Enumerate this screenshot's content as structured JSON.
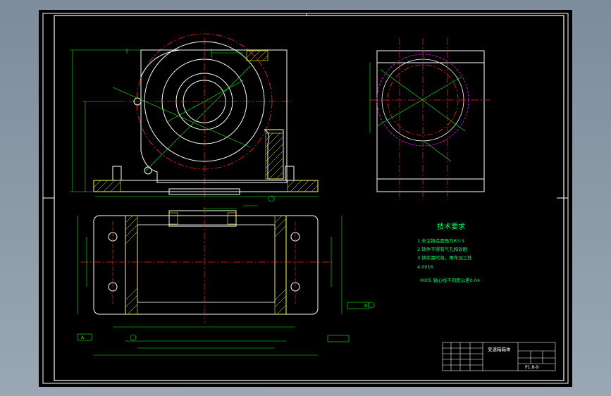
{
  "drawing": {
    "colors": {
      "background": "#000000",
      "outline": "#ffffff",
      "center_line": "#ff2020",
      "dimension": "#00ff00",
      "hatch": "#ffff00",
      "hidden": "#ff00ff",
      "notes": "#00ff66",
      "app_frame": "#8c9aa8"
    },
    "tech_req": {
      "title": "技术要求",
      "items": [
        "1.未注铸造圆角为R3-5",
        "2.铸件不得有气孔和砂眼",
        "3.铸件需时效，再车加工处",
        "4.0016",
        "0005 轴心线不同度公差0.04"
      ]
    },
    "title_block": {
      "name": "变速箱箱体",
      "drawing_no": "P1.8-9"
    },
    "labels": {
      "datum_a": "A",
      "datum_b": "B"
    }
  }
}
